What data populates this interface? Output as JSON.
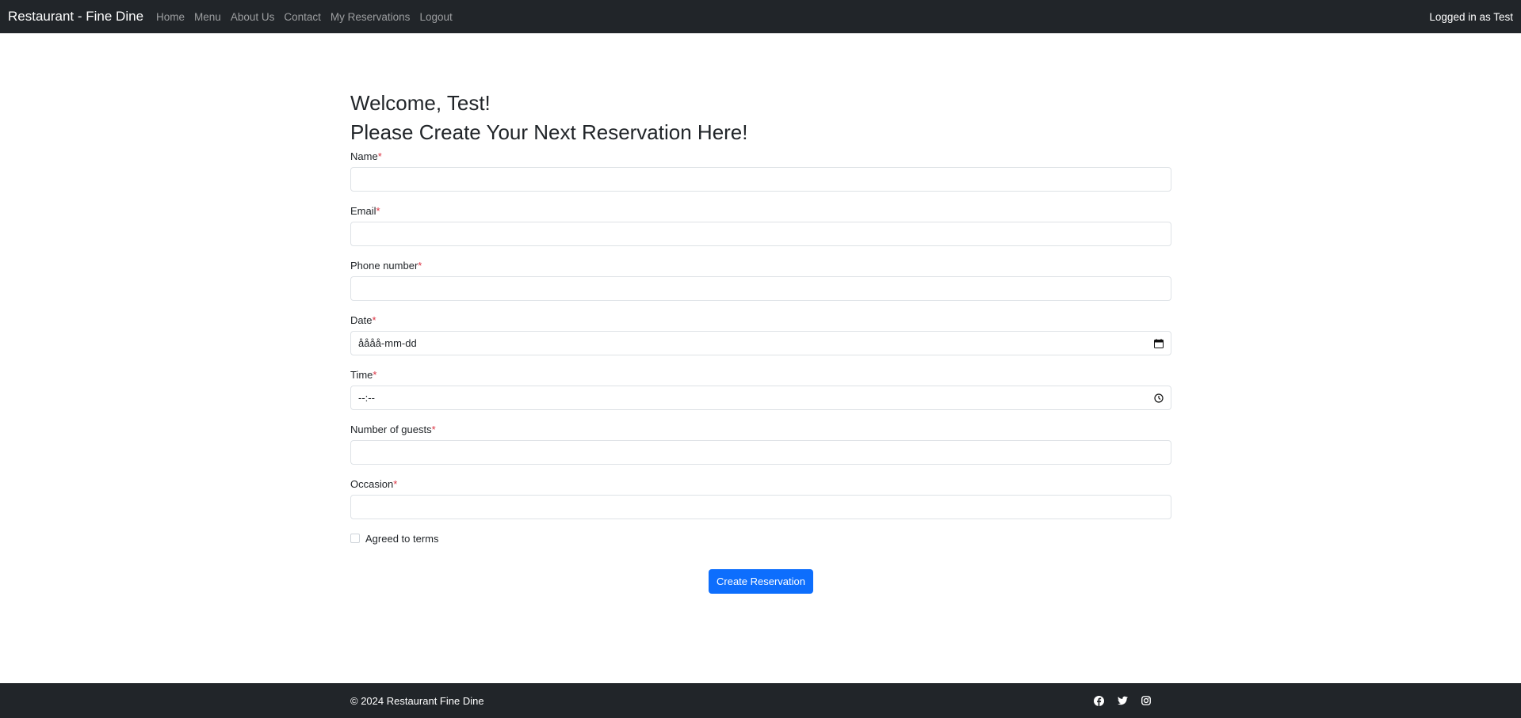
{
  "navbar": {
    "brand": "Restaurant - Fine Dine",
    "links": [
      "Home",
      "Menu",
      "About Us",
      "Contact",
      "My Reservations",
      "Logout"
    ],
    "status": "Logged in as Test"
  },
  "main": {
    "welcome": "Welcome, Test!",
    "subtitle": "Please Create Your Next Reservation Here!",
    "form": {
      "required_mark": "*",
      "name_label": "Name",
      "name_value": "",
      "email_label": "Email",
      "email_value": "",
      "phone_label": "Phone number",
      "phone_value": "",
      "date_label": "Date",
      "date_value": "åååå-mm-dd",
      "time_label": "Time",
      "time_value": "--:--",
      "guests_label": "Number of guests",
      "guests_value": "",
      "occasion_label": "Occasion",
      "occasion_value": "",
      "terms_label": "Agreed to terms",
      "submit_label": "Create Reservation"
    }
  },
  "footer": {
    "copyright": "© 2024 Restaurant Fine Dine",
    "social_icons": [
      "facebook-icon",
      "twitter-icon",
      "instagram-icon"
    ]
  },
  "colors": {
    "navbar_bg": "#212529",
    "primary": "#0d6efd",
    "required": "#dc3545"
  }
}
